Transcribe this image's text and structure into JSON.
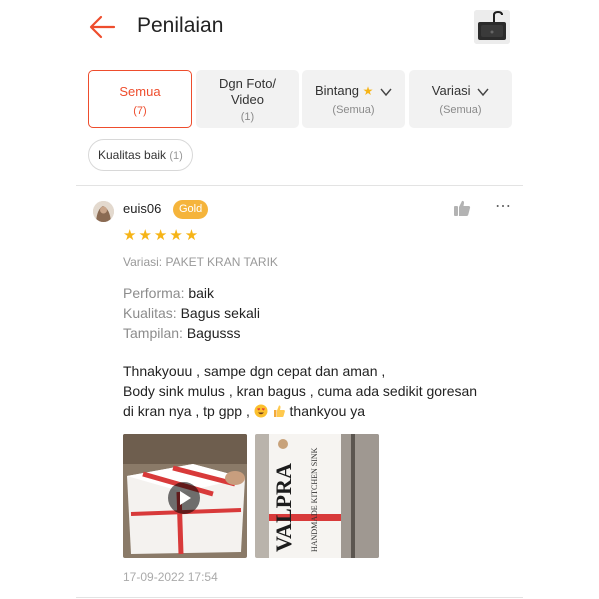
{
  "header": {
    "title": "Penilaian"
  },
  "filters": {
    "all": {
      "label": "Semua",
      "count": "(7)"
    },
    "media": {
      "label_line1": "Dgn Foto/",
      "label_line2": "Video",
      "count": "(1)"
    },
    "rating": {
      "label": "Bintang",
      "sub": "(Semua)"
    },
    "variant": {
      "label": "Variasi",
      "sub": "(Semua)"
    }
  },
  "tag_filter": {
    "label": "Kualitas baik",
    "count": "(1)"
  },
  "review": {
    "username": "euis06",
    "badge": "Gold",
    "rating": 5,
    "stars_text": "★★★★★",
    "variant": "Variasi: PAKET KRAN TARIK",
    "attributes": [
      {
        "key": "Performa:",
        "value": "baik"
      },
      {
        "key": "Kualitas:",
        "value": "Bagus sekali"
      },
      {
        "key": "Tampilan:",
        "value": "Bagusss"
      }
    ],
    "text_line1": "Thnakyouu , sampe dgn cepat dan aman ,",
    "text_line2": "Body sink mulus , kran bagus , cuma ada sedikit goresan",
    "text_line3a": "di kran nya , tp gpp ,",
    "text_line3b": "thankyou ya",
    "box_brand": "VALPRA",
    "box_sub": "HANDMADE KITCHEN SINK",
    "date": "17-09-2022 17:54"
  },
  "colors": {
    "accent": "#ee4d2d",
    "star": "#f6b417",
    "badge": "#f5b43b"
  },
  "icons": {
    "back": "arrow-left-icon",
    "chevron": "chevron-down-icon",
    "like": "thumbs-up-icon",
    "more": "more-dots-icon",
    "play": "play-icon"
  }
}
